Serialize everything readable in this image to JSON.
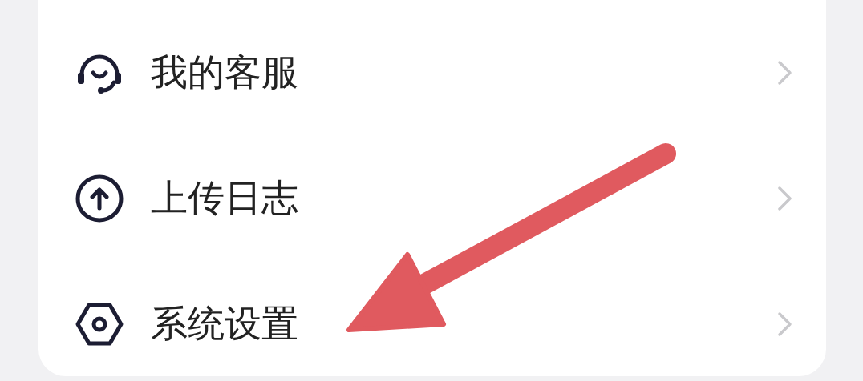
{
  "menu": [
    {
      "kind": "support",
      "label": "我的客服"
    },
    {
      "kind": "upload",
      "label": "上传日志"
    },
    {
      "kind": "settings",
      "label": "系统设置"
    }
  ]
}
